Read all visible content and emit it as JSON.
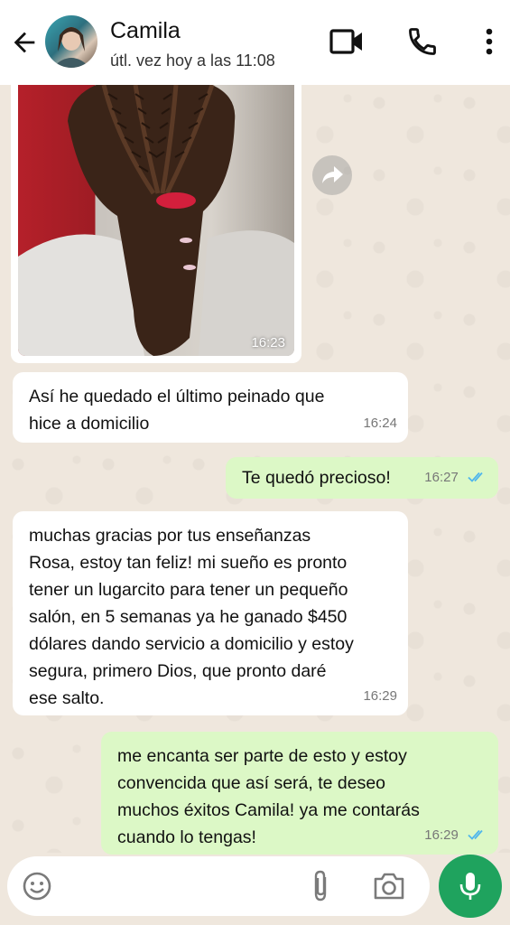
{
  "header": {
    "contact_name": "Camila",
    "last_seen": "útl. vez hoy a las 11:08",
    "icons": [
      "back-arrow-icon",
      "video-call-icon",
      "phone-icon",
      "more-vert-icon"
    ]
  },
  "messages": [
    {
      "type": "photo",
      "direction": "in",
      "time": "16:23"
    },
    {
      "type": "text",
      "direction": "in",
      "text_lines": [
        "Así he quedado el último peinado que",
        "hice a domicilio"
      ],
      "time": "16:24"
    },
    {
      "type": "text",
      "direction": "out",
      "text_lines": [
        "Te quedó precioso!"
      ],
      "time": "16:27",
      "status": "read"
    },
    {
      "type": "text",
      "direction": "in",
      "text_lines": [
        "muchas gracias por tus enseñanzas",
        "Rosa, estoy tan feliz! mi sueño es pronto",
        "tener un lugarcito para tener un pequeño",
        "salón, en 5 semanas ya he ganado $450",
        "dólares dando servicio a domicilio y estoy",
        "segura, primero Dios, que pronto daré",
        "ese salto."
      ],
      "time": "16:29"
    },
    {
      "type": "text",
      "direction": "out",
      "text_lines": [
        "me encanta ser parte de esto y estoy",
        "convencida que así será, te deseo",
        "muchos éxitos Camila! ya me contarás",
        "cuando lo tengas!"
      ],
      "time": "16:29",
      "status": "read"
    }
  ],
  "colors": {
    "chat_bg": "#efe7dd",
    "incoming_bubble": "#ffffff",
    "outgoing_bubble": "#dcf8c6",
    "read_ticks": "#4fb6ec",
    "mic_button": "#1fa35e"
  },
  "input_bar": {
    "icons": [
      "emoji-icon",
      "attach-icon",
      "camera-icon",
      "mic-icon"
    ]
  }
}
